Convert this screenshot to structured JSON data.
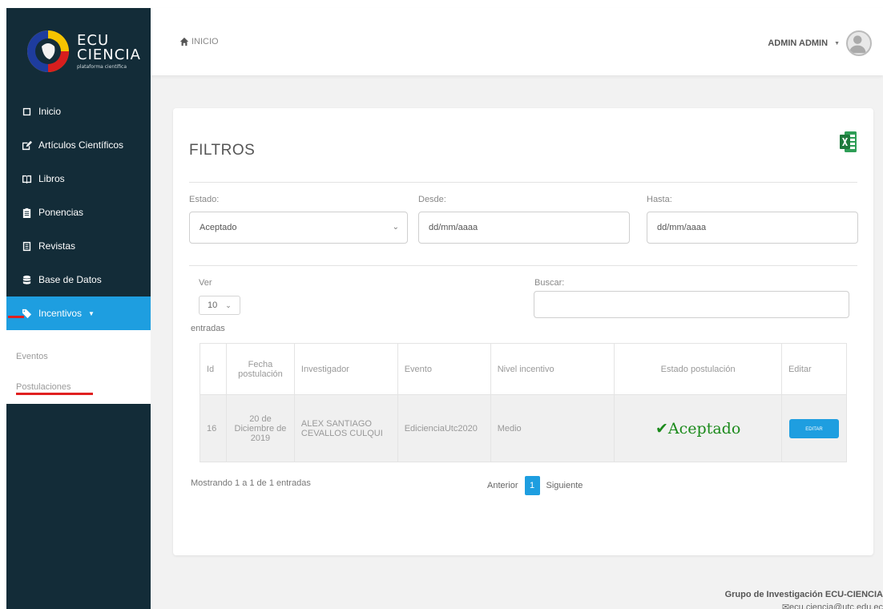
{
  "brand": {
    "line1": "ECU",
    "line2": "CIENCIA",
    "tagline": "plataforma científica"
  },
  "sidebar": {
    "items": [
      {
        "label": "Inicio",
        "icon": "square-icon"
      },
      {
        "label": "Artículos Científicos",
        "icon": "edit-icon"
      },
      {
        "label": "Libros",
        "icon": "book-icon"
      },
      {
        "label": "Ponencias",
        "icon": "clipboard-icon"
      },
      {
        "label": "Revistas",
        "icon": "document-icon"
      },
      {
        "label": "Base de Datos",
        "icon": "database-icon"
      },
      {
        "label": "Incentivos",
        "icon": "tags-icon",
        "active": true
      }
    ],
    "submenu": [
      "Eventos",
      "Postulaciones"
    ]
  },
  "topbar": {
    "breadcrumb": "INICIO",
    "user": "ADMIN ADMIN"
  },
  "filters": {
    "title": "FILTROS",
    "estado_label": "Estado:",
    "estado_value": "Aceptado",
    "desde_label": "Desde:",
    "desde_value": "dd/mm/aaaa",
    "hasta_label": "Hasta:",
    "hasta_value": "dd/mm/aaaa"
  },
  "table_controls": {
    "ver_label": "Ver",
    "page_size": "10",
    "entries_label": "entradas",
    "search_label": "Buscar:",
    "search_value": ""
  },
  "table": {
    "headers": [
      "Id",
      "Fecha postulación",
      "Investigador",
      "Evento",
      "Nivel incentivo",
      "Estado postulación",
      "Editar"
    ],
    "rows": [
      {
        "id": "16",
        "fecha": "20 de Diciembre de 2019",
        "investigador": "ALEX SANTIAGO CEVALLOS CULQUI",
        "evento": "EdicienciaUtc2020",
        "nivel": "Medio",
        "estado": "✔Aceptado",
        "editar": "EDITAR"
      }
    ]
  },
  "pagination": {
    "info": "Mostrando 1 a 1 de 1 entradas",
    "prev": "Anterior",
    "current": "1",
    "next": "Siguiente"
  },
  "footer": {
    "group": "Grupo de Investigación ECU-CIENCIA",
    "email": "✉ecu.ciencia@utc.edu.ec"
  },
  "colors": {
    "sidebar": "#132c38",
    "accent": "#1e9ee0",
    "success": "#1b8a1b",
    "marker": "#e02020"
  }
}
